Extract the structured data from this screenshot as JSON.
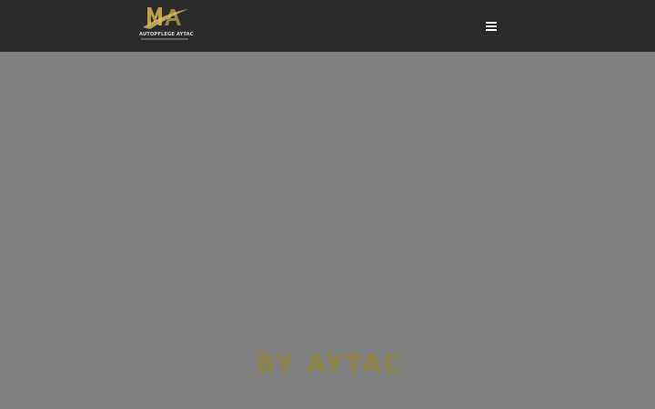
{
  "header": {
    "logo_text": "AUTOPFLEGE AYTAC",
    "menu_icon": "hamburger-menu-icon"
  },
  "hero": {
    "title": "BY AYTAC"
  },
  "colors": {
    "header_bg": "#2b2b2b",
    "page_bg": "#7f7f7f",
    "accent_gold": "#8e8440"
  }
}
